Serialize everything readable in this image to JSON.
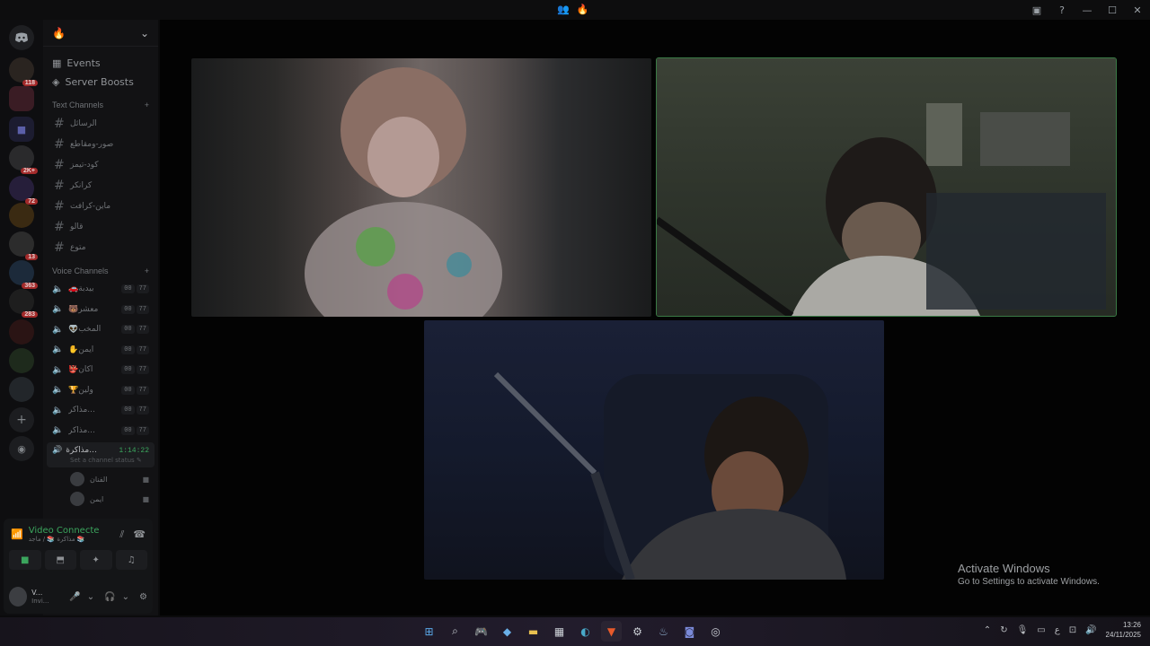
{
  "window": {
    "title_icons": [
      "users-icon",
      "fire-icon"
    ],
    "controls": [
      "inbox-icon",
      "help-icon",
      "minimize-icon",
      "maximize-icon",
      "close-icon"
    ]
  },
  "guilds": [
    {
      "name": "discord-home",
      "badge": ""
    },
    {
      "name": "server-1",
      "badge": "118"
    },
    {
      "name": "server-2",
      "badge": ""
    },
    {
      "name": "folder",
      "badge": ""
    },
    {
      "name": "server-4",
      "badge": "2K+"
    },
    {
      "name": "server-5",
      "badge": "72"
    },
    {
      "name": "server-6",
      "badge": ""
    },
    {
      "name": "server-7",
      "badge": "13"
    },
    {
      "name": "server-8",
      "badge": "363"
    },
    {
      "name": "server-9",
      "badge": "283"
    },
    {
      "name": "server-10",
      "badge": ""
    },
    {
      "name": "server-11",
      "badge": ""
    },
    {
      "name": "server-12",
      "badge": ""
    }
  ],
  "server": {
    "name_icon": "fire-icon",
    "events_label": "Events",
    "boosts_label": "Server Boosts",
    "text_category": "Text Channels",
    "voice_category": "Voice Channels"
  },
  "text_channels": [
    "الرسائل",
    "صور-ومقاطع",
    "كود-تيمز",
    "كرانكر",
    "ماين-كرافت",
    "قالو",
    "متوع"
  ],
  "voice_channels": [
    {
      "name": "🚗بيدبة",
      "count": "00",
      "limit": "77"
    },
    {
      "name": "🐻معشر",
      "count": "00",
      "limit": "77"
    },
    {
      "name": "👽المخب",
      "count": "00",
      "limit": "77"
    },
    {
      "name": "✋ايمن",
      "count": "00",
      "limit": "77"
    },
    {
      "name": "👺اكان",
      "count": "00",
      "limit": "77"
    },
    {
      "name": "🏆ولين",
      "count": "00",
      "limit": "77"
    },
    {
      "name": "مذاكر...",
      "count": "00",
      "limit": "77"
    },
    {
      "name": "مذاكر...",
      "count": "00",
      "limit": "77"
    }
  ],
  "active_voice": {
    "name": "مذاكرة...",
    "timer": "1:14:22",
    "status_placeholder": "Set a channel status",
    "members": [
      "الفنان",
      "ايمن"
    ]
  },
  "voice_panel": {
    "title": "Video Connecte",
    "subtitle": "مذاكرة 📚 / ماجد 📚",
    "buttons": [
      "camera-icon",
      "screenshare-icon",
      "activities-icon",
      "soundboard-icon"
    ]
  },
  "user": {
    "name": "V...",
    "status": "Invi..."
  },
  "stage": {
    "tiles": [
      {
        "label": ""
      },
      {
        "label": ""
      },
      {
        "label": ""
      }
    ]
  },
  "watermark": {
    "line1": "Activate Windows",
    "line2": "Go to Settings to activate Windows."
  },
  "taskbar": {
    "apps": [
      "windows-start-icon",
      "search-icon",
      "gamepad-icon",
      "copilot-icon",
      "file-explorer-icon",
      "store-icon",
      "edge-icon",
      "brave-icon",
      "settings-icon",
      "steam-icon",
      "discord-icon",
      "obs-icon"
    ],
    "time": "13:26",
    "date": "24/11/2025",
    "lang": "ع"
  }
}
